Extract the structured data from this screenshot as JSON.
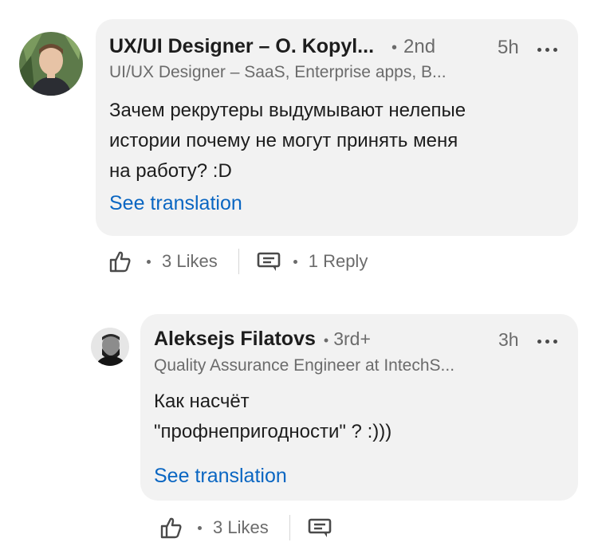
{
  "comments": [
    {
      "author": "UX/UI Designer – O. Kopyl...",
      "degree": "2nd",
      "time": "5h",
      "headline": "UI/UX Designer – SaaS, Enterprise apps, B...",
      "text_line1": "Зачем рекрутеры выдумывают нелепые",
      "text_line2": "истории почему не могут принять меня",
      "text_line3": "на работу? :D",
      "translate_label": "See translation",
      "likes": "3 Likes",
      "replies": "1 Reply"
    },
    {
      "author": "Aleksejs Filatovs",
      "degree": "3rd+",
      "time": "3h",
      "headline": "Quality Assurance Engineer at IntechS...",
      "text_line1": "Как насчёт",
      "text_line2": "\"профнепригодности\" ? :)))",
      "translate_label": "See translation",
      "likes": "3 Likes"
    }
  ],
  "icons": {
    "like": "like-icon",
    "comment": "comment-icon",
    "more": "more-dots-icon"
  },
  "colors": {
    "link": "#0a66c2",
    "bubble": "#f2f2f2",
    "muted": "#6b6b6b"
  }
}
